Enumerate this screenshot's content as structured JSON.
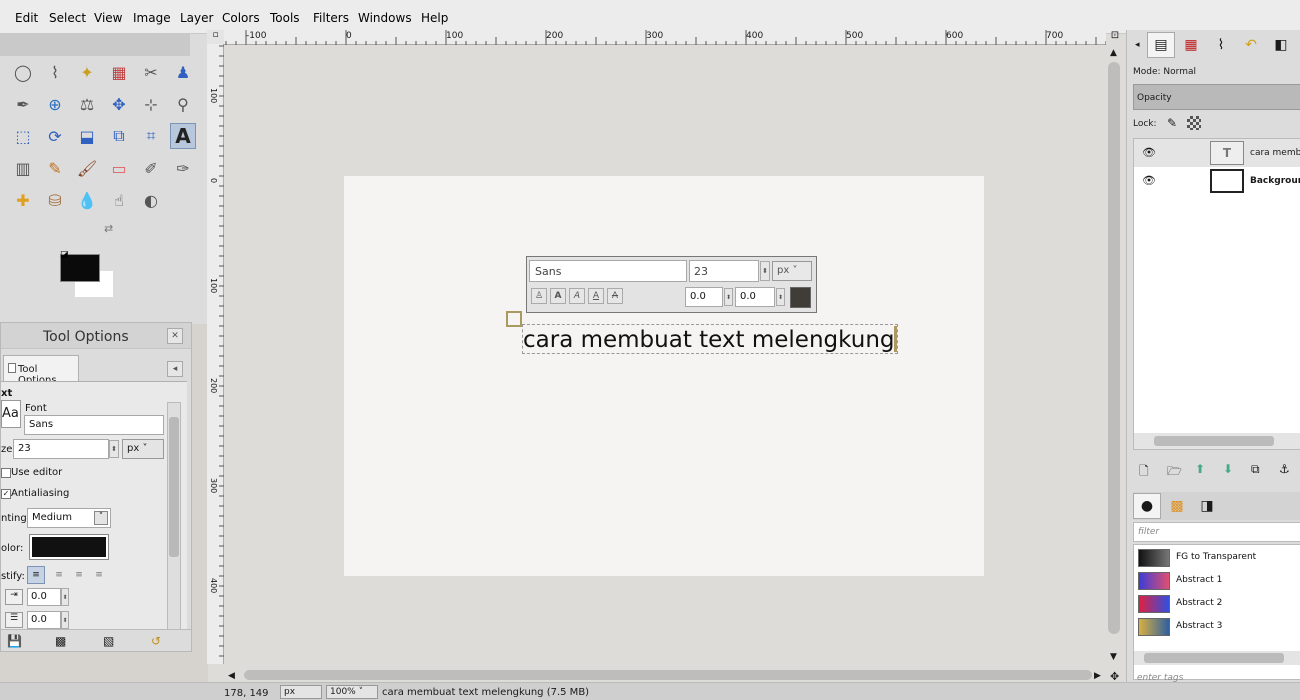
{
  "menu": [
    "Edit",
    "Select",
    "View",
    "Image",
    "Layer",
    "Colors",
    "Tools",
    "Filters",
    "Windows",
    "Help"
  ],
  "ruler": {
    "h_labels": [
      "-100",
      "0",
      "100",
      "200",
      "300",
      "400",
      "500",
      "600",
      "700"
    ],
    "v_labels": [
      "100",
      "0",
      "100",
      "200",
      "300",
      "400"
    ]
  },
  "tool_options": {
    "title": "Tool Options",
    "tab_label": "Tool Options",
    "section": "xt",
    "aa_glyph": "Aa",
    "font_label": "Font",
    "font_value": "Sans",
    "size_label": "ze:",
    "size_value": "23",
    "unit": "px",
    "use_editor": "Use editor",
    "antialiasing": "Antialiasing",
    "hinting_label": "nting:",
    "hinting_value": "Medium",
    "color_label": "olor:",
    "justify_label": "stify:",
    "indent_value": "0.0",
    "line_spacing_value": "0.0"
  },
  "text_editor": {
    "font": "Sans",
    "size": "23",
    "unit": "px",
    "baseline": "0.0",
    "kerning": "0.0"
  },
  "canvas_text": "cara membuat text melengkung",
  "layers": {
    "mode_label": "Mode: Normal",
    "opacity_label": "Opacity",
    "lock_label": "Lock:",
    "items": [
      {
        "name": "cara membu"
      },
      {
        "name": "Backgroun"
      }
    ]
  },
  "gradients": {
    "filter_placeholder": "filter",
    "items": [
      {
        "name": "FG to Transparent",
        "color_a": "#111111",
        "color_b": "#777777"
      },
      {
        "name": "Abstract 1",
        "color_a": "#3c3cd8",
        "color_b": "#e05070"
      },
      {
        "name": "Abstract 2",
        "color_a": "#e02040",
        "color_b": "#3050e0"
      },
      {
        "name": "Abstract 3",
        "color_a": "#d8b040",
        "color_b": "#3060a0"
      }
    ],
    "tags_placeholder": "enter tags"
  },
  "status": {
    "coords": "178, 149",
    "unit": "px",
    "zoom": "100%",
    "message": "cara membuat text melengkung (7.5 MB)"
  },
  "colors": {
    "fg": "#0a0a0a",
    "bg": "#ffffff",
    "text_color": "#111111"
  }
}
